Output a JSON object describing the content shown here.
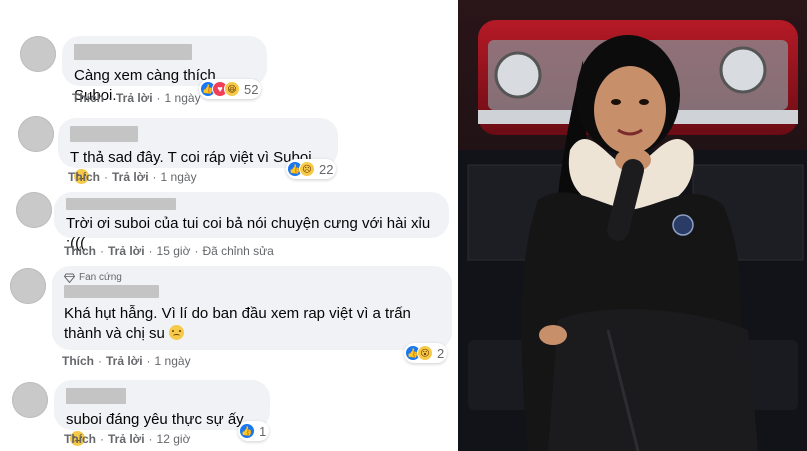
{
  "comments": [
    {
      "text": "Càng xem càng thích Suboi.",
      "emoji": "",
      "actions": {
        "like": "Thích",
        "reply": "Trả lời",
        "time": "1 ngày",
        "edited": ""
      },
      "reactions": {
        "icons": [
          "like",
          "love",
          "haha"
        ],
        "count": "52"
      }
    },
    {
      "text": "T thả sad đây. T coi ráp việt vì Suboi",
      "emoji": "sad-face",
      "actions": {
        "like": "Thích",
        "reply": "Trả lời",
        "time": "1 ngày",
        "edited": ""
      },
      "reactions": {
        "icons": [
          "like",
          "sad"
        ],
        "count": "22"
      }
    },
    {
      "text": "Trời ơi suboi của tui coi bả nói chuyện cưng với hài xỉu :(((",
      "emoji": "",
      "actions": {
        "like": "Thích",
        "reply": "Trả lời",
        "time": "15 giờ",
        "edited": "Đã chỉnh sửa"
      },
      "reactions": null
    },
    {
      "badge": "Fan cứng",
      "text": "Khá hụt hẫng. Vì lí do ban đầu xem rap việt vì a trấn thành và chị su",
      "emoji": "disappointed-face",
      "actions": {
        "like": "Thích",
        "reply": "Trả lời",
        "time": "1 ngày",
        "edited": ""
      },
      "reactions": {
        "icons": [
          "like",
          "wow"
        ],
        "count": "2"
      }
    },
    {
      "text": "suboi đáng yêu thực sự ấy",
      "emoji": "pleading-face",
      "actions": {
        "like": "Thích",
        "reply": "Trả lời",
        "time": "12 giờ",
        "edited": ""
      },
      "reactions": {
        "icons": [
          "like"
        ],
        "count": "1"
      }
    }
  ],
  "colors": {
    "bubble": "#f0f2f5",
    "meta_text": "#65676b",
    "like_blue": "#1877f2",
    "love_red": "#f33e58",
    "emoji_yellow": "#f7c948"
  },
  "photo": {
    "subject": "woman-in-black-leather-jacket-portrait"
  }
}
